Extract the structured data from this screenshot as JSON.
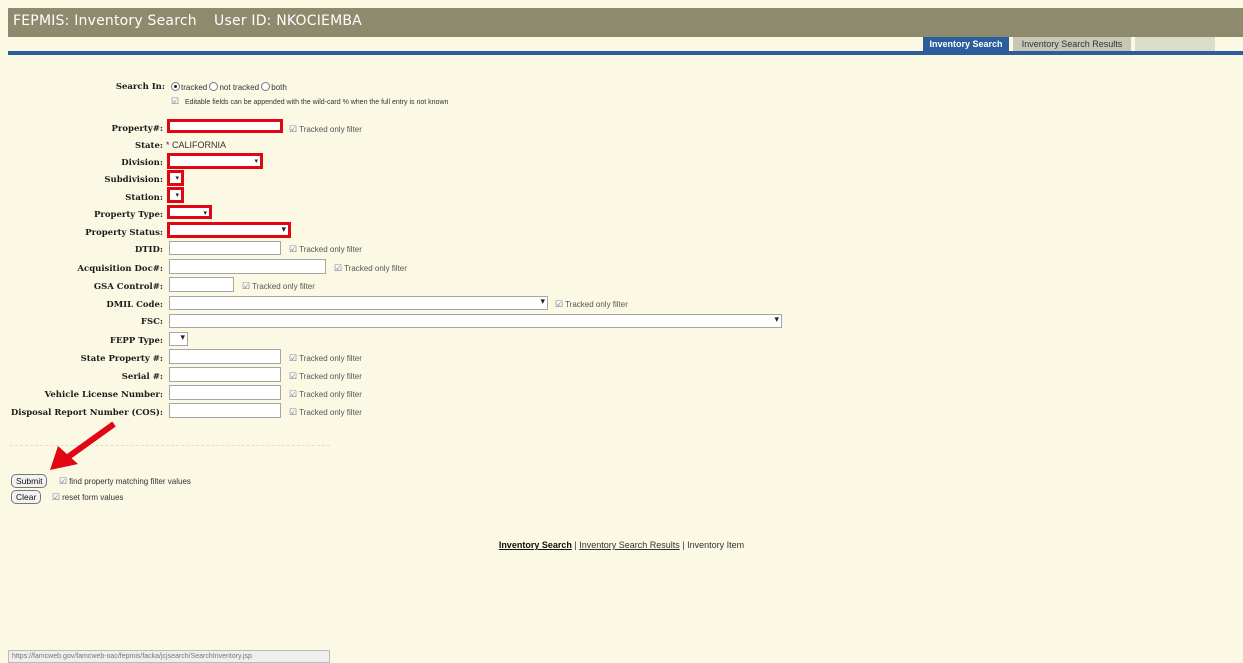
{
  "header": {
    "title": "FEPMIS: Inventory Search",
    "user": "User ID: NKOCIEMBA"
  },
  "tabs": [
    {
      "label": "Inventory Search",
      "active": true
    },
    {
      "label": "Inventory Search Results",
      "active": false
    },
    {
      "label": "",
      "active": false
    }
  ],
  "search_in": {
    "label": "Search In:",
    "options": [
      "tracked",
      "not tracked",
      "both"
    ],
    "selected": "tracked",
    "hint": "Editable fields can be appended with the wild-card % when the full entry is not known"
  },
  "fields": {
    "property": {
      "label": "Property#:",
      "value": "",
      "filter": "Tracked only filter"
    },
    "state": {
      "label": "State:",
      "value": "* CALIFORNIA"
    },
    "division": {
      "label": "Division:",
      "value": ""
    },
    "subdivision": {
      "label": "Subdivision:",
      "value": ""
    },
    "station": {
      "label": "Station:",
      "value": ""
    },
    "property_type": {
      "label": "Property Type:",
      "value": ""
    },
    "property_status": {
      "label": "Property Status:",
      "value": ""
    },
    "dtid": {
      "label": "DTID:",
      "value": "",
      "filter": "Tracked only filter"
    },
    "acquisition": {
      "label": "Acquisition Doc#:",
      "value": "",
      "filter": "Tracked only filter"
    },
    "gsa": {
      "label": "GSA Control#:",
      "value": "",
      "filter": "Tracked only filter"
    },
    "dmil": {
      "label": "DMIL Code:",
      "value": "",
      "filter": "Tracked only filter"
    },
    "fsc": {
      "label": "FSC:",
      "value": ""
    },
    "fepp": {
      "label": "FEPP Type:",
      "value": ""
    },
    "state_property": {
      "label": "State Property #:",
      "value": "",
      "filter": "Tracked only filter"
    },
    "serial": {
      "label": "Serial #:",
      "value": "",
      "filter": "Tracked only filter"
    },
    "vehicle": {
      "label": "Vehicle License Number:",
      "value": "",
      "filter": "Tracked only filter"
    },
    "disposal": {
      "label": "Disposal Report Number (COS):",
      "value": "",
      "filter": "Tracked only filter"
    }
  },
  "actions": {
    "submit_label": "Submit",
    "submit_hint": "find property matching filter values",
    "clear_label": "Clear",
    "clear_hint": "reset form values"
  },
  "footer_links": {
    "search": "Inventory Search",
    "sep1": "|",
    "results": "Inventory Search Results",
    "sep2": "|",
    "item": "Inventory Item"
  },
  "status_bar": "https://famcweb.gov/famcweb-oac/fepmis/facka/jcjsearch/SearchInventory.jsp",
  "colors": {
    "header_bg": "#8d8a6e",
    "accent_blue": "#2b5e9b",
    "page_bg": "#fbf9e4",
    "annotation_red": "#e10613"
  }
}
